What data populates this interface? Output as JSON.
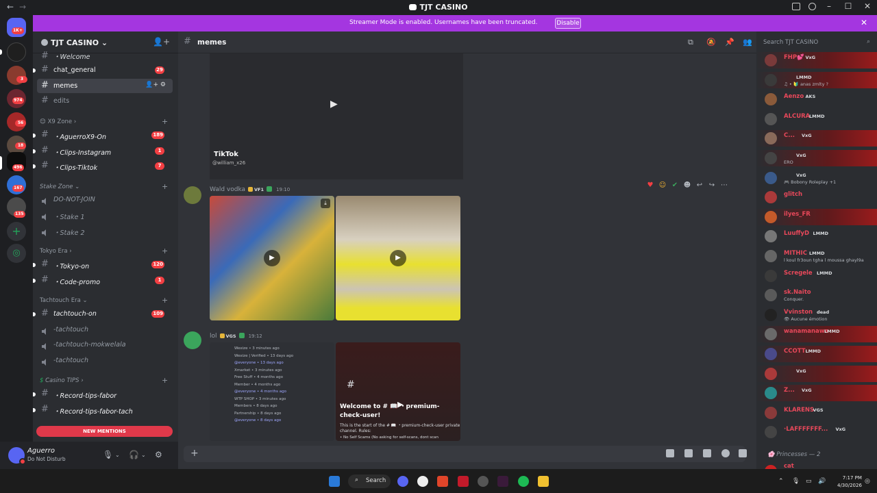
{
  "window": {
    "title": "TJT CASINO",
    "nav_back": "←",
    "nav_forward": "→",
    "minimize": "–",
    "maximize": "☐",
    "close": "✕"
  },
  "rail": {
    "home_badge": "1K+",
    "badges": [
      "3",
      "974",
      "56",
      "18",
      "496",
      "167",
      "135"
    ]
  },
  "banner": {
    "message": "Streamer Mode is enabled. Usernames have been truncated.",
    "disable_label": "Disable",
    "close": "✕"
  },
  "server": {
    "name": "TJT CASINO ⌄",
    "invite_icon": "👤+"
  },
  "channels": {
    "welcome": "・Welcome",
    "chat_general": "chat_general",
    "chat_general_count": "29",
    "memes": "memes",
    "memes_actions": "👤+ ⚙",
    "edits": "edits",
    "cat_x9": "X9 Zone ›",
    "aguerro": "・AguerroX9-On",
    "aguerro_count": "189",
    "clips_instagram": "・Clips-Instagram",
    "clips_instagram_count": "1",
    "clips_tiktok": "・Clips-Tiktok",
    "clips_tiktok_count": "7",
    "cat_stake": "Stake Zone ⌄",
    "do_not_join": "DO-NOT-JOIN",
    "stake1": "・Stake 1",
    "stake2": "・Stake 2",
    "cat_tokyo": "Tokyo Era ›",
    "tokyo_on": "・Tokyo-on",
    "tokyo_on_count": "120",
    "code_promo": "・Code-promo",
    "code_promo_count": "1",
    "cat_tachtouch": "Tachtouch Era ⌄",
    "tachtouch_on": "tachtouch-on",
    "tachtouch_on_count": "109",
    "tachtouch_v1": "-tachtouch",
    "tachtouch_mokwelala": "-tachtouch-mokwelala",
    "tachtouch_v2": "-tachtouch",
    "cat_casino": "Casino TIPS ›",
    "record_tips_fabor": "・Record-tips-fabor",
    "record_tips_fabor_tach": "・Record-tips-fabor-tach",
    "new_mentions": "NEW MENTIONS"
  },
  "user": {
    "name": "Aguerro",
    "status": "Do Not Disturb"
  },
  "channel_header": {
    "name": "memes"
  },
  "messages": {
    "tiktok_label": "TikTok",
    "tiktok_handle": "@william_x26",
    "m1_author": "Wald vodka",
    "m1_tag": "VF1",
    "m1_time": "19:10",
    "m2_author": "lol",
    "m2_tag": "VGS",
    "m2_time": "19:12",
    "welcome_title": "Welcome to # 📖 ・premium-check-user!",
    "welcome_sub": "This is the start of the # 📖 ・premium-check-user private channel. Rules:",
    "welcome_rule": "• No Self Scams (No asking for self-scans, dont scan",
    "chat_lines": [
      "Wexize • 3 minutes ago",
      "Wexize | Verified • 13 days ago",
      "@everyone • 13 days ago",
      "Xmarket • 3 minutes ago",
      "Free Stuff • 4 months ago",
      "Member • 4 months ago",
      "@everyone • 4 months ago",
      "WTP SHOP • 3 minutes ago",
      "Members • 8 days ago",
      "Partnership • 8 days ago",
      "@everyone • 8 days ago"
    ]
  },
  "search": {
    "placeholder": "Search TJT CASINO"
  },
  "members": {
    "list": [
      {
        "name": "FHP💕",
        "tag": "VxG",
        "status": ""
      },
      {
        "name": "",
        "tag": "LMMD",
        "status": "♫ • 🔰 anas zmlty ?"
      },
      {
        "name": "Aenzo",
        "tag": "AKS",
        "status": ""
      },
      {
        "name": "ALCURA",
        "tag": "LMMD",
        "status": ""
      },
      {
        "name": "C...",
        "tag": "VxG",
        "status": ""
      },
      {
        "name": "",
        "tag": "VxG",
        "status": "ERO"
      },
      {
        "name": "",
        "tag": "VxG",
        "status": "🎮 Bobony Roleplay +1"
      },
      {
        "name": "glitch",
        "tag": "",
        "status": ""
      },
      {
        "name": "ilyes_FR",
        "tag": "",
        "status": ""
      },
      {
        "name": "LuuffyD",
        "tag": "LMMD",
        "status": ""
      },
      {
        "name": "MITHIC",
        "tag": "LMMD",
        "status": "l koul fr3oun tgha l moussa ghayl9a"
      },
      {
        "name": "Scregele",
        "tag": "LMMD",
        "status": ""
      },
      {
        "name": "sk.Naito",
        "tag": "",
        "status": "Conquer."
      },
      {
        "name": "Vvinston",
        "tag": "dead",
        "status": "👁 Aucune émotion"
      },
      {
        "name": "wanamanawa",
        "tag": "LMMD",
        "status": ""
      },
      {
        "name": "CCOTT",
        "tag": "LMMD",
        "status": ""
      },
      {
        "name": "",
        "tag": "VxG",
        "status": ""
      },
      {
        "name": "Z...",
        "tag": "VxG",
        "status": ""
      },
      {
        "name": "KLARENS",
        "tag": "VGS",
        "status": ""
      },
      {
        "name": "·LAFFFFFFF...",
        "tag": "VxG",
        "status": ""
      }
    ],
    "group_header": "Princesses — 2",
    "last_name": "cat"
  },
  "taskbar": {
    "search_label": "Search",
    "time": "7:17 PM",
    "date": "4/30/2026"
  },
  "colors": {
    "banner": "#a436e0",
    "mention_red": "#f23f43",
    "sidebar": "#2b2d31",
    "main": "#313338"
  }
}
